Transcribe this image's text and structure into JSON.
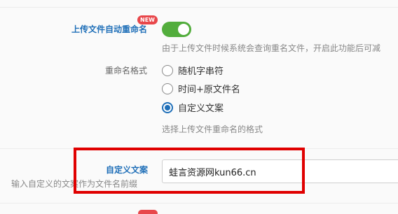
{
  "settings": {
    "auto_rename": {
      "label": "上传文件自动重命名",
      "badge": "NEW",
      "enabled": true,
      "description": "由于上传文件时候系统会查询重名文件，开启此功能后可减"
    },
    "rename_format": {
      "label": "重命名格式",
      "options": [
        {
          "label": "随机字串符",
          "checked": false
        },
        {
          "label": "时间+原文件名",
          "checked": false
        },
        {
          "label": "自定义文案",
          "checked": true
        }
      ],
      "description": "选择上传文件重命名的格式"
    },
    "custom_text": {
      "label": "自定义文案",
      "description": "输入自定义的文案作为文件名前缀",
      "value": "蛙言资源网kun66.cn"
    }
  },
  "colors": {
    "accent": "#1f6fb8",
    "toggle_on": "#52ad3c",
    "badge": "#e8474b",
    "highlight": "#e00000"
  }
}
